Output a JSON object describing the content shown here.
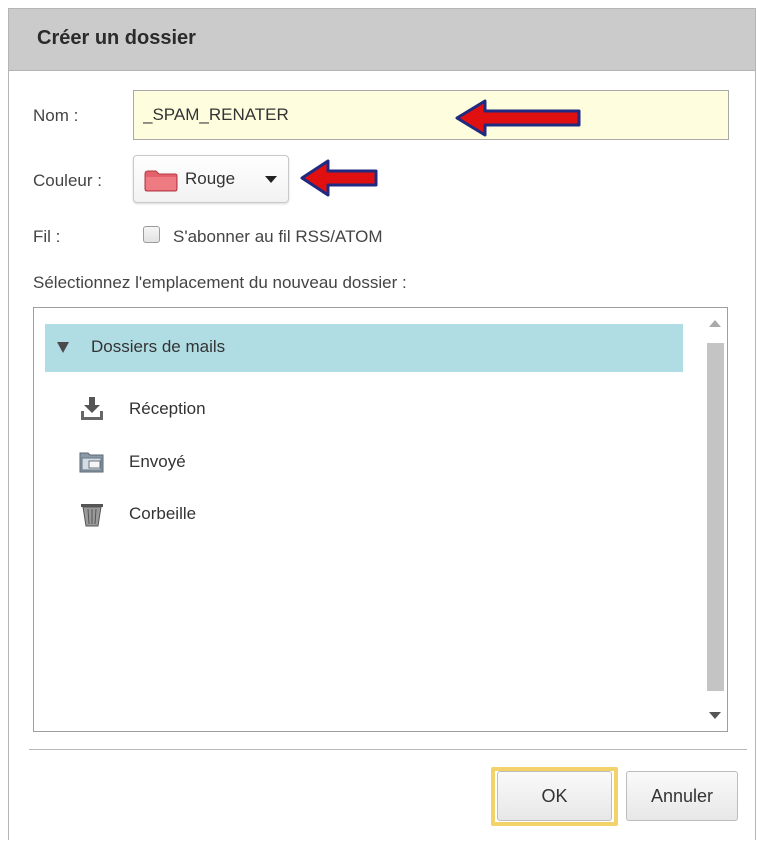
{
  "dialog": {
    "title": "Créer un dossier",
    "name_label": "Nom :",
    "name_value": "_SPAM_RENATER",
    "color_label": "Couleur :",
    "color_value": "Rouge",
    "feed_label": "Fil :",
    "subscribe_label": "S'abonner au fil RSS/ATOM",
    "subscribe_checked": false,
    "location_label": "Sélectionnez l'emplacement du nouveau dossier :",
    "tree": {
      "root_label": "Dossiers de mails",
      "items": [
        {
          "label": "Réception",
          "icon": "inbox-download-icon"
        },
        {
          "label": "Envoyé",
          "icon": "sent-folder-icon"
        },
        {
          "label": "Corbeille",
          "icon": "trash-icon"
        }
      ]
    },
    "buttons": {
      "ok": "OK",
      "cancel": "Annuler"
    }
  },
  "colors": {
    "titlebar": "#cbcbcb",
    "input_bg": "#fefedf",
    "tree_header": "#b0dde3",
    "arrow": "#e01010",
    "ok_highlight": "#f4d26b",
    "folder_red": "#e4606a"
  }
}
